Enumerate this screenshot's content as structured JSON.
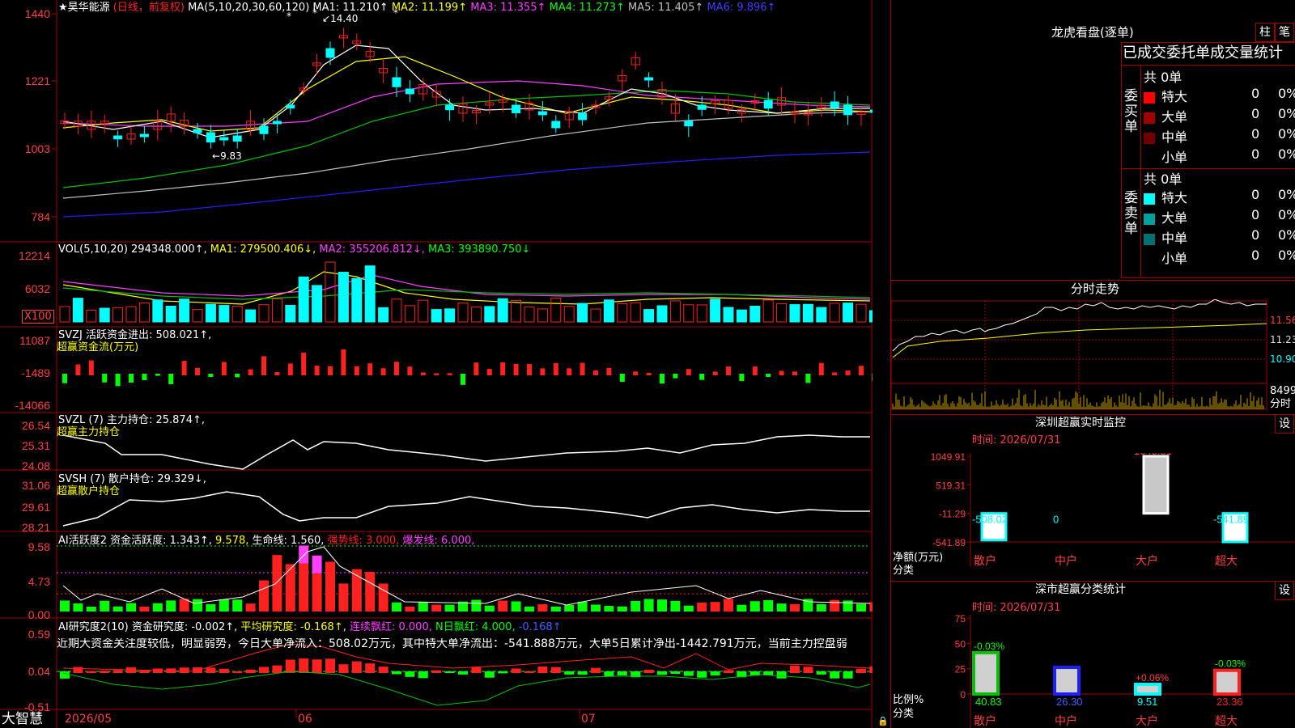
{
  "stock": {
    "name": "★昊华能源",
    "mode": "(日线，前复权)",
    "ma_text": "MA(5,10,20,30,60,120)",
    "ma_values": [
      {
        "t": "MA1: 11.210↑",
        "c": "#ffffff"
      },
      {
        "t": "MA2: 11.199↑",
        "c": "#ffff00"
      },
      {
        "t": "MA3: 11.355↑",
        "c": "#ff40ff"
      },
      {
        "t": "MA4: 11.273↑",
        "c": "#00ff00"
      },
      {
        "t": "MA5: 11.405↑",
        "c": "#c0c0c0"
      },
      {
        "t": "MA6: 9.896↑",
        "c": "#4040ff"
      }
    ],
    "price_axis": [
      "1440",
      "1221",
      "1003",
      "784"
    ],
    "high_mark": "14.40",
    "low_mark": "9.83",
    "lock_icon": "lock-icon"
  },
  "vol": {
    "header": "VOL(5,10,20)  294348.000↑,",
    "ma": [
      {
        "t": "MA1: 279500.406↓,",
        "c": "#ffff00"
      },
      {
        "t": "MA2: 355206.812↓,",
        "c": "#ff40ff"
      },
      {
        "t": "MA3: 393890.750↓",
        "c": "#00ff00"
      }
    ],
    "axis": [
      "12214",
      "6032"
    ],
    "unit": "X100"
  },
  "svzj": {
    "header": "SVZJ  活跃资金进出: 508.021↑,",
    "sub": "超赢资金流(万元)",
    "axis": [
      "11087",
      "-1489",
      "-14066"
    ]
  },
  "svzl": {
    "header": "SVZL (7) 主力持仓: 25.874↑,",
    "sub": "超赢主力持仓",
    "axis": [
      "26.54",
      "25.31",
      "24.08"
    ]
  },
  "svsh": {
    "header": "SVSH (7) 散户持仓: 29.329↓,",
    "sub": "超赢散户持仓",
    "axis": [
      "31.06",
      "29.61",
      "28.21"
    ]
  },
  "ai_active": {
    "header_parts": [
      {
        "t": "AI活跃度2 资金活跃度: 1.343↑,",
        "c": "#ffffff"
      },
      {
        "t": "9.578,",
        "c": "#ffff00"
      },
      {
        "t": "生命线: 1.560,",
        "c": "#ffffff"
      },
      {
        "t": "强势线: 3.000,",
        "c": "#ff2020"
      },
      {
        "t": "爆发线: 6.000,",
        "c": "#ff40ff"
      }
    ],
    "axis": [
      "9.58",
      "4.73",
      "0.00"
    ]
  },
  "ai_research": {
    "header_parts": [
      {
        "t": "AI研究度2(10) 资金研究度: -0.002↑,",
        "c": "#ffffff"
      },
      {
        "t": "平均研究度: -0.168↑,",
        "c": "#ffff00"
      },
      {
        "t": "连续飘红: 0.000,",
        "c": "#ff40ff"
      },
      {
        "t": "N日飘红: 4.000,",
        "c": "#00ff00"
      },
      {
        "t": "-0.168↑",
        "c": "#4060ff"
      }
    ],
    "comment": "近期大资金关注度较低，明显弱势，今日大单净流入：508.02万元，其中特大单净流出：-541.888万元，大单5日累计净出-1442.791万元，当前主力控盘弱",
    "axis": [
      "0.59",
      "0.04",
      "-0.51"
    ]
  },
  "footer": {
    "brand": "大智慧",
    "dates": [
      "2026/05",
      "06",
      "07"
    ]
  },
  "right": {
    "dragon_title": "龙虎看盘(逐单)",
    "btn1": "柱",
    "btn2": "笔",
    "tabs": "已成交委托单成交量统计",
    "buy_label": "委买单",
    "sell_label": "委卖单",
    "buy_total": "共 0单",
    "sell_total": "共 0单",
    "buy_rows": [
      {
        "name": "特大",
        "n": "0",
        "p": "0%",
        "c": "#ff0000"
      },
      {
        "name": "大单",
        "n": "0",
        "p": "0%",
        "c": "#a00000"
      },
      {
        "name": "中单",
        "n": "0",
        "p": "0%",
        "c": "#700000"
      },
      {
        "name": "小单",
        "n": "0",
        "p": "0%",
        "c": ""
      }
    ],
    "sell_rows": [
      {
        "name": "特大",
        "n": "0",
        "p": "0%",
        "c": "#00ffff"
      },
      {
        "name": "大单",
        "n": "0",
        "p": "0%",
        "c": "#00a0a0"
      },
      {
        "name": "中单",
        "n": "0",
        "p": "0%",
        "c": "#007070"
      },
      {
        "name": "小单",
        "n": "0",
        "p": "0%",
        "c": ""
      }
    ],
    "intraday_title": "分时走势",
    "intraday_axis": [
      "11.56",
      "11.23",
      "10.90"
    ],
    "intraday_vol": "8499",
    "intraday_vol_label": "分时",
    "monitor_title": "深圳超赢实时监控",
    "monitor_set": "设",
    "monitor_time": "时间: 2026/07/31",
    "monitor_axis": [
      "1049.91",
      "519.31",
      "-11.29",
      "-541.89"
    ],
    "monitor_ylabel": "净额(万元)",
    "monitor_xlabel": "分类",
    "stats_title": "深市超赢分类统计",
    "stats_set": "设",
    "stats_time": "时间: 2026/07/31",
    "stats_axis": [
      "75",
      "50",
      "25",
      "0"
    ],
    "stats_ylabel": "比例%",
    "stats_xlabel": "分类"
  },
  "chart_data": [
    {
      "type": "bar",
      "title": "深圳超赢实时监控",
      "ylabel": "净额(万元)",
      "xlabel": "分类",
      "categories": [
        "散户",
        "中户",
        "大户",
        "超大"
      ],
      "values": [
        -508.02,
        0,
        1049.91,
        -541.89
      ],
      "value_labels": [
        "-508.02",
        "0",
        "1049.91",
        "-541.89"
      ],
      "ylim": [
        -541.89,
        1049.91
      ]
    },
    {
      "type": "bar",
      "title": "深市超赢分类统计",
      "ylabel": "比例%",
      "xlabel": "分类",
      "categories": [
        "散户",
        "中户",
        "大户",
        "超大"
      ],
      "values": [
        40.83,
        26.3,
        9.51,
        23.36
      ],
      "changes": [
        "-0.03%",
        "",
        "+0.06%",
        "-0.03%"
      ],
      "ylim": [
        0,
        75
      ]
    }
  ]
}
